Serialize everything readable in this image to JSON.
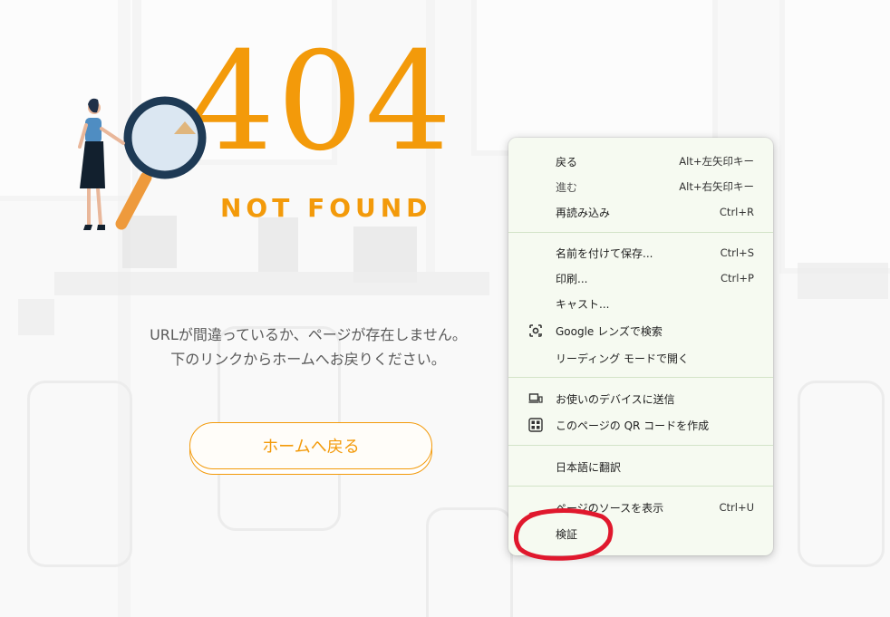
{
  "error": {
    "code": "404",
    "title": "NOT FOUND",
    "message_line1": "URLが間違っているか、ページが存在しません。",
    "message_line2": "下のリンクからホームへお戻りください。",
    "home_button": "ホームへ戻る",
    "accent_color": "#f39a0a"
  },
  "context_menu": {
    "items": [
      {
        "label": "戻る",
        "shortcut": "Alt+左矢印キー",
        "icon": ""
      },
      {
        "label": "進む",
        "shortcut": "Alt+右矢印キー",
        "icon": "",
        "disabled": true
      },
      {
        "label": "再読み込み",
        "shortcut": "Ctrl+R",
        "icon": ""
      },
      {
        "label": "名前を付けて保存...",
        "shortcut": "Ctrl+S",
        "icon": ""
      },
      {
        "label": "印刷...",
        "shortcut": "Ctrl+P",
        "icon": ""
      },
      {
        "label": "キャスト...",
        "shortcut": "",
        "icon": ""
      },
      {
        "label": "Google レンズで検索",
        "shortcut": "",
        "icon": "google-lens-icon"
      },
      {
        "label": "リーディング モードで開く",
        "shortcut": "",
        "icon": ""
      },
      {
        "label": "お使いのデバイスに送信",
        "shortcut": "",
        "icon": "send-to-device-icon"
      },
      {
        "label": "このページの QR コードを作成",
        "shortcut": "",
        "icon": "qr-code-icon"
      },
      {
        "label": "日本語に翻訳",
        "shortcut": "",
        "icon": ""
      },
      {
        "label": "ページのソースを表示",
        "shortcut": "Ctrl+U",
        "icon": ""
      },
      {
        "label": "検証",
        "shortcut": "",
        "icon": ""
      }
    ]
  },
  "annotation": {
    "color": "#e0182d",
    "target": "検証"
  }
}
